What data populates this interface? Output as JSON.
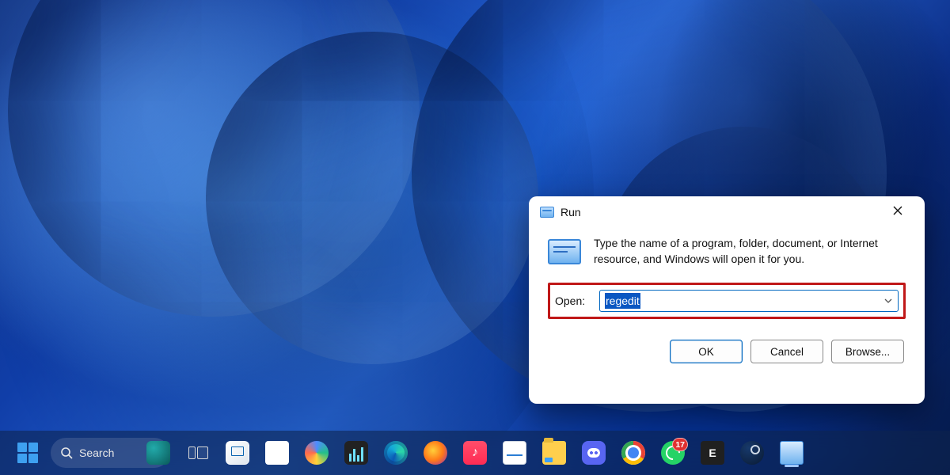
{
  "run_dialog": {
    "title": "Run",
    "description": "Type the name of a program, folder, document, or Internet resource, and Windows will open it for you.",
    "open_label": "Open:",
    "input_value": "regedit",
    "buttons": {
      "ok": "OK",
      "cancel": "Cancel",
      "browse": "Browse..."
    }
  },
  "taskbar": {
    "search_label": "Search",
    "whatsapp_badge": "17"
  }
}
